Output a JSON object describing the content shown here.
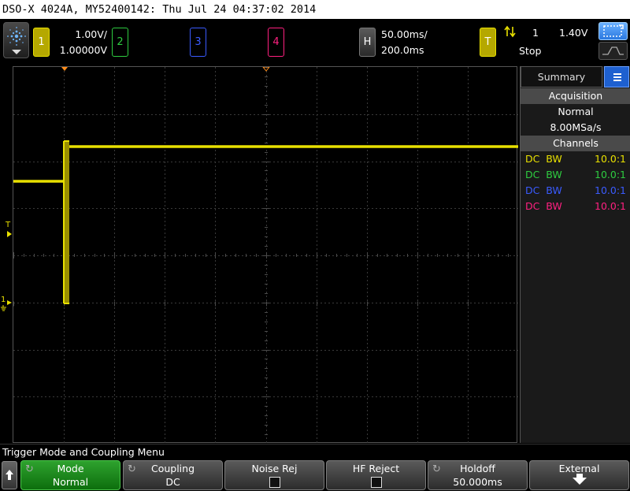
{
  "title_bar": "DSO-X 4024A, MY52400142: Thu Jul 24 04:37:02 2014",
  "channels": [
    {
      "number": "1",
      "scale": "1.00V/",
      "offset": "1.00000V",
      "color": "#e8e000"
    },
    {
      "number": "2",
      "color": "#2ecc40"
    },
    {
      "number": "3",
      "color": "#3a5bff"
    },
    {
      "number": "4",
      "color": "#ff2080"
    }
  ],
  "horizontal": {
    "label": "H",
    "timebase": "50.00ms/",
    "delay": "200.0ms"
  },
  "trigger": {
    "label": "T",
    "slope_icon": "rising-falling-edge-icon",
    "source": "1",
    "level": "1.40V",
    "status": "Stop"
  },
  "side_panel": {
    "tab_label": "Summary",
    "acquisition_header": "Acquisition",
    "acquisition_mode": "Normal",
    "sample_rate": "8.00MSa/s",
    "channels_header": "Channels",
    "channel_rows": [
      {
        "coupling": "DC",
        "bw": "BW",
        "probe": "10.0:1",
        "color": "#e8e000"
      },
      {
        "coupling": "DC",
        "bw": "BW",
        "probe": "10.0:1",
        "color": "#2ecc40"
      },
      {
        "coupling": "DC",
        "bw": "BW",
        "probe": "10.0:1",
        "color": "#3a5bff"
      },
      {
        "coupling": "DC",
        "bw": "BW",
        "probe": "10.0:1",
        "color": "#ff2080"
      }
    ]
  },
  "graticule": {
    "trigger_marker": "T",
    "ground_marker": "1"
  },
  "menu": {
    "title": "Trigger Mode and Coupling Menu",
    "softkeys": [
      {
        "label": "Mode",
        "value": "Normal"
      },
      {
        "label": "Coupling",
        "value": "DC"
      },
      {
        "label": "Noise Rej",
        "value": ""
      },
      {
        "label": "HF Reject",
        "value": ""
      },
      {
        "label": "Holdoff",
        "value": "50.000ms"
      },
      {
        "label": "External",
        "value": ""
      }
    ]
  },
  "waveform": {
    "channel": "1",
    "description": "step: low level before edge, high level after edge"
  }
}
